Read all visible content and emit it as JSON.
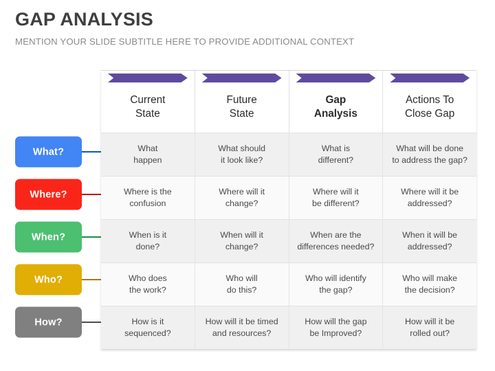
{
  "header": {
    "title": "GAP ANALYSIS",
    "subtitle": "MENTION YOUR SLIDE SUBTITLE HERE TO PROVIDE ADDITIONAL CONTEXT"
  },
  "colors": {
    "chevron_purple": "#5f4b9e",
    "title_gray": "#3f3f3f",
    "subtitle_gray": "#8a8a8a",
    "row_shade_a": "#f0f0f0",
    "row_shade_b": "#fafafa"
  },
  "columns": [
    {
      "label": "Current\nState",
      "bold": false
    },
    {
      "label": "Future\nState",
      "bold": false
    },
    {
      "label": "Gap\nAnalysis",
      "bold": true
    },
    {
      "label": "Actions To\nClose Gap",
      "bold": false
    }
  ],
  "row_labels": [
    {
      "text": "What?",
      "color": "#4285f4",
      "connector": "#1457b8"
    },
    {
      "text": "Where?",
      "color": "#fa2519",
      "connector": "#c80000"
    },
    {
      "text": "When?",
      "color": "#4cbf70",
      "connector": "#1d8a48"
    },
    {
      "text": "Who?",
      "color": "#e0ae05",
      "connector": "#a37c00"
    },
    {
      "text": "How?",
      "color": "#808080",
      "connector": "#4d4d4d"
    }
  ],
  "rows": [
    {
      "shade": "shade-a",
      "cells": [
        "What\nhappen",
        "What should\nit look like?",
        "What is\ndifferent?",
        "What will be done\nto address the gap?"
      ]
    },
    {
      "shade": "shade-b",
      "cells": [
        "Where is the\nconfusion",
        "Where will it\nchange?",
        "Where will it\nbe different?",
        "Where will it be\naddressed?"
      ]
    },
    {
      "shade": "shade-a",
      "cells": [
        "When is it\ndone?",
        "When will it\nchange?",
        "When are the\ndifferences needed?",
        "When it will be\naddressed?"
      ]
    },
    {
      "shade": "shade-b",
      "cells": [
        "Who does\nthe work?",
        "Who will\ndo this?",
        "Who will identify\nthe gap?",
        "Who will make\nthe decision?"
      ]
    },
    {
      "shade": "shade-a",
      "cells": [
        "How is it\nsequenced?",
        "How will it be timed\nand resources?",
        "How will the gap\nbe Improved?",
        "How will it be\nrolled out?"
      ]
    }
  ]
}
